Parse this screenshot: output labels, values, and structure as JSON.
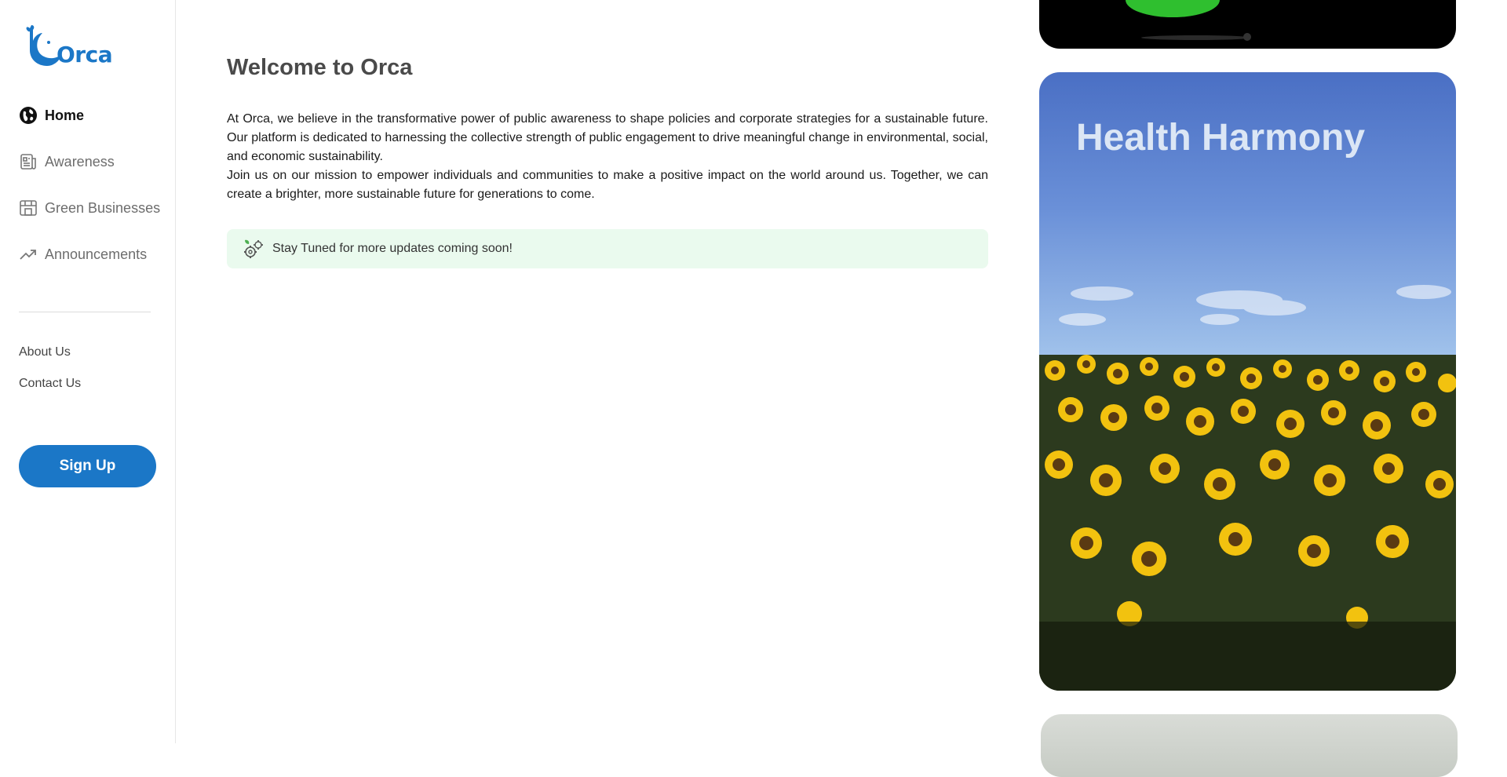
{
  "brand": {
    "name": "Orca",
    "color": "#1b77c7"
  },
  "nav": {
    "items": [
      {
        "label": "Home",
        "icon": "globe-icon",
        "active": true
      },
      {
        "label": "Awareness",
        "icon": "newspaper-icon",
        "active": false
      },
      {
        "label": "Green Businesses",
        "icon": "storefront-icon",
        "active": false
      },
      {
        "label": "Announcements",
        "icon": "trending-up-icon",
        "active": false
      }
    ],
    "secondary": [
      {
        "label": "About Us"
      },
      {
        "label": "Contact Us"
      }
    ],
    "signup_label": "Sign Up"
  },
  "main": {
    "title": "Welcome to Orca",
    "paragraphs": [
      "At Orca, we believe in the transformative power of public awareness to shape policies and corporate strategies for a sustainable future. Our platform is dedicated to harnessing the collective strength of public engagement to drive meaningful change in environmental, social, and economic sustainability.",
      "Join us on our mission to empower individuals and communities to make a positive impact on the world around us. Together, we can create a brighter, more sustainable future for generations to come."
    ],
    "notice": {
      "text": "Stay Tuned for more updates coming soon!",
      "icon": "gears-icon",
      "background": "#eafaee"
    }
  },
  "cards": [
    {
      "title": ""
    },
    {
      "title": "Health Harmony"
    },
    {
      "title": ""
    }
  ]
}
